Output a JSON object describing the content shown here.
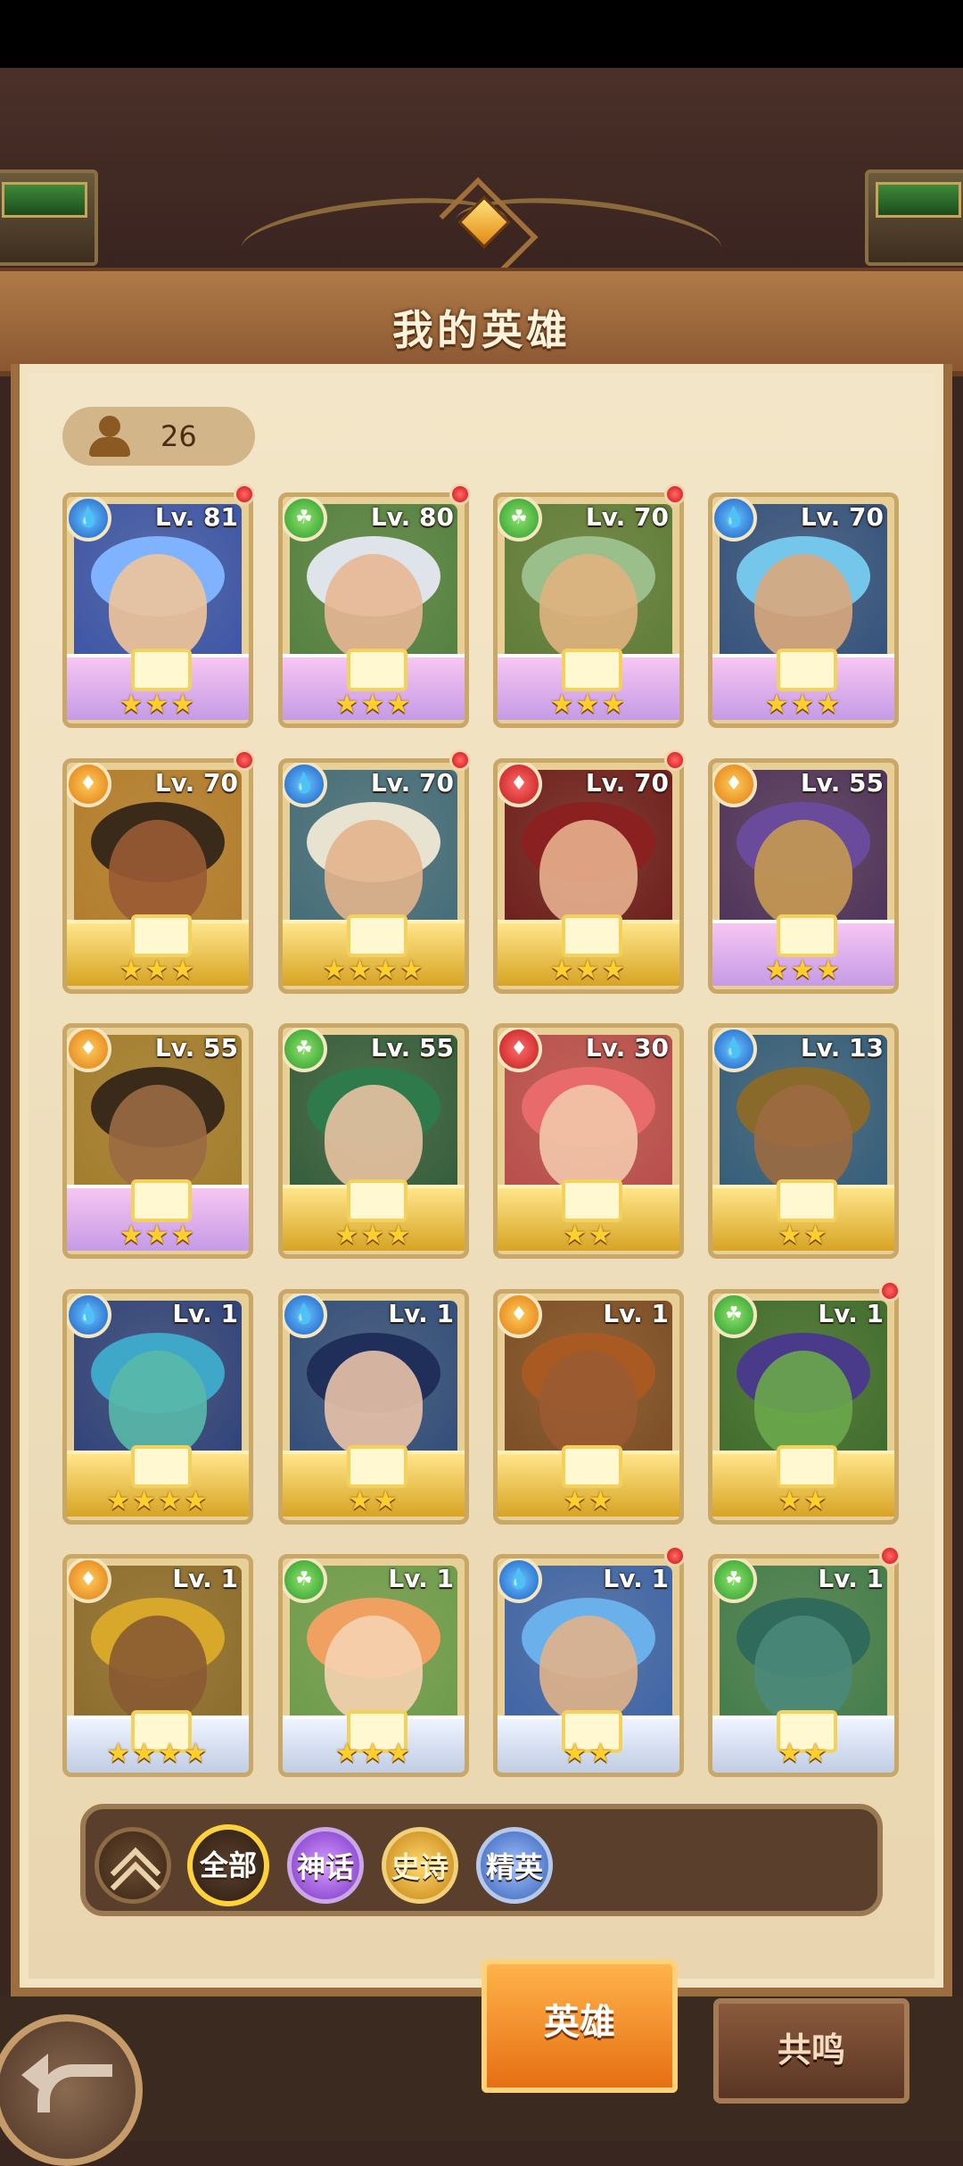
{
  "header": {
    "title": "我的英雄"
  },
  "hero_count": {
    "icon": "person-icon",
    "value": "26"
  },
  "heroes": [
    {
      "level": "Lv. 81",
      "element": "water",
      "rarity": "mythic",
      "stars": "★★★",
      "notify": true,
      "hair": "#7fb2ff",
      "skin": "#f0c49a",
      "bg": "#3752a8"
    },
    {
      "level": "Lv. 80",
      "element": "nature",
      "rarity": "mythic",
      "stars": "★★★",
      "notify": true,
      "hair": "#dfe4ea",
      "skin": "#e7b795",
      "bg": "#4f7f3f"
    },
    {
      "level": "Lv. 70",
      "element": "nature",
      "rarity": "mythic",
      "stars": "★★★",
      "notify": true,
      "hair": "#9bbf8a",
      "skin": "#e0b27f",
      "bg": "#5b7a36"
    },
    {
      "level": "Lv. 70",
      "element": "water",
      "rarity": "mythic",
      "stars": "★★★",
      "notify": false,
      "hair": "#74c7ea",
      "skin": "#d9a77c",
      "bg": "#2f4f7e"
    },
    {
      "level": "Lv. 70",
      "element": "fire",
      "rarity": "epic",
      "stars": "★★★",
      "notify": true,
      "hair": "#3a2a1a",
      "skin": "#9a5a34",
      "bg": "#b07a2a"
    },
    {
      "level": "Lv. 70",
      "element": "water",
      "rarity": "epic",
      "stars": "★★★★",
      "notify": true,
      "hair": "#e8e2d0",
      "skin": "#e2b48c",
      "bg": "#3f6a7a"
    },
    {
      "level": "Lv. 70",
      "element": "blood",
      "rarity": "epic",
      "stars": "★★★",
      "notify": true,
      "hair": "#8a2020",
      "skin": "#e7b08e",
      "bg": "#6a1a1a"
    },
    {
      "level": "Lv. 55",
      "element": "fire",
      "rarity": "mythic",
      "stars": "★★★",
      "notify": false,
      "hair": "#6a4a9a",
      "skin": "#c79a52",
      "bg": "#4a2f5a"
    },
    {
      "level": "Lv. 55",
      "element": "fire",
      "rarity": "mythic",
      "stars": "★★★",
      "notify": false,
      "hair": "#3a2a1a",
      "skin": "#9a6a42",
      "bg": "#a07a2a"
    },
    {
      "level": "Lv. 55",
      "element": "nature",
      "rarity": "epic",
      "stars": "★★★",
      "notify": false,
      "hair": "#2f7a4a",
      "skin": "#e8c2a2",
      "bg": "#2f5a3a"
    },
    {
      "level": "Lv. 30",
      "element": "blood",
      "rarity": "epic",
      "stars": "★★",
      "notify": false,
      "hair": "#e86a6a",
      "skin": "#f2c7aa",
      "bg": "#b74a4a"
    },
    {
      "level": "Lv. 13",
      "element": "water",
      "rarity": "epic",
      "stars": "★★",
      "notify": false,
      "hair": "#8a6a2a",
      "skin": "#9c6a40",
      "bg": "#2f5a7a"
    },
    {
      "level": "Lv. 1",
      "element": "water",
      "rarity": "epic",
      "stars": "★★★★",
      "notify": false,
      "hair": "#3fa7c7",
      "skin": "#59b9a9",
      "bg": "#2a3f7a"
    },
    {
      "level": "Lv. 1",
      "element": "water",
      "rarity": "epic",
      "stars": "★★",
      "notify": false,
      "hair": "#1f2f5a",
      "skin": "#e9c2a8",
      "bg": "#2c4a7a"
    },
    {
      "level": "Lv. 1",
      "element": "fire",
      "rarity": "epic",
      "stars": "★★",
      "notify": false,
      "hair": "#a85a22",
      "skin": "#9a5a32",
      "bg": "#7a4a22"
    },
    {
      "level": "Lv. 1",
      "element": "nature",
      "rarity": "epic",
      "stars": "★★",
      "notify": true,
      "hair": "#4a3a8a",
      "skin": "#6aa84a",
      "bg": "#3a6a2a"
    },
    {
      "level": "Lv. 1",
      "element": "fire",
      "rarity": "elite",
      "stars": "★★★★",
      "notify": false,
      "hair": "#d8a82a",
      "skin": "#8a5a32",
      "bg": "#8a6a2a"
    },
    {
      "level": "Lv. 1",
      "element": "nature",
      "rarity": "elite",
      "stars": "★★★",
      "notify": false,
      "hair": "#f0a060",
      "skin": "#f5d2b0",
      "bg": "#6a9a4a"
    },
    {
      "level": "Lv. 1",
      "element": "water",
      "rarity": "elite",
      "stars": "★★",
      "notify": true,
      "hair": "#6ab0ea",
      "skin": "#e0b28a",
      "bg": "#3a62a8"
    },
    {
      "level": "Lv. 1",
      "element": "nature",
      "rarity": "elite",
      "stars": "★★",
      "notify": true,
      "hair": "#2f6a5a",
      "skin": "#4a8a7a",
      "bg": "#3f7a4a"
    }
  ],
  "filters": {
    "collapse_icon": "double-chevron-up-icon",
    "all": "全部",
    "mythic": "神话",
    "epic": "史诗",
    "elite": "精英"
  },
  "tabs": {
    "heroes": "英雄",
    "resonance": "共鸣"
  },
  "back_icon": "back-arrow-icon",
  "colors": {
    "accent": "#e66f14",
    "panel": "#f2e3c3",
    "frame": "#9a6e3f"
  }
}
